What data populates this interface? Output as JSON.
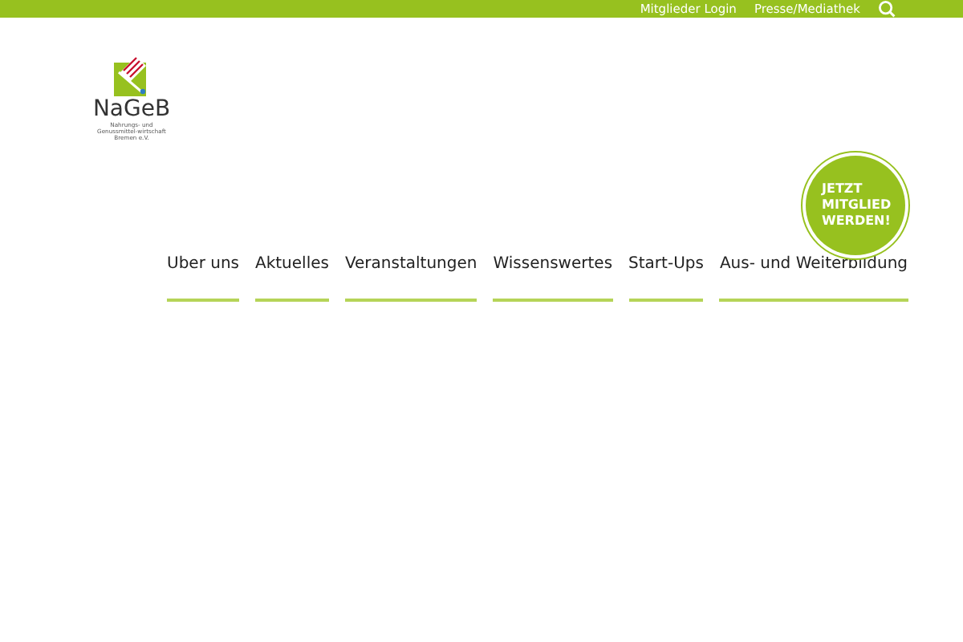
{
  "topbar": {
    "links": [
      "Mitglieder Login",
      "Presse/Mediathek"
    ]
  },
  "logo": {
    "name": "NaGeB",
    "tagline": "Nahrungs- und Genussmittel-wirtschaft Bremen e.V."
  },
  "badge": {
    "lines": [
      "JETZT",
      "MITGLIED",
      "WERDEN!"
    ]
  },
  "nav": [
    {
      "label": "Uber uns"
    },
    {
      "label": "Aktuelles"
    },
    {
      "label": "Veranstaltungen"
    },
    {
      "label": "Wissenswertes"
    },
    {
      "label": "Start-Ups"
    },
    {
      "label": "Aus- und Weiterbildung"
    }
  ]
}
